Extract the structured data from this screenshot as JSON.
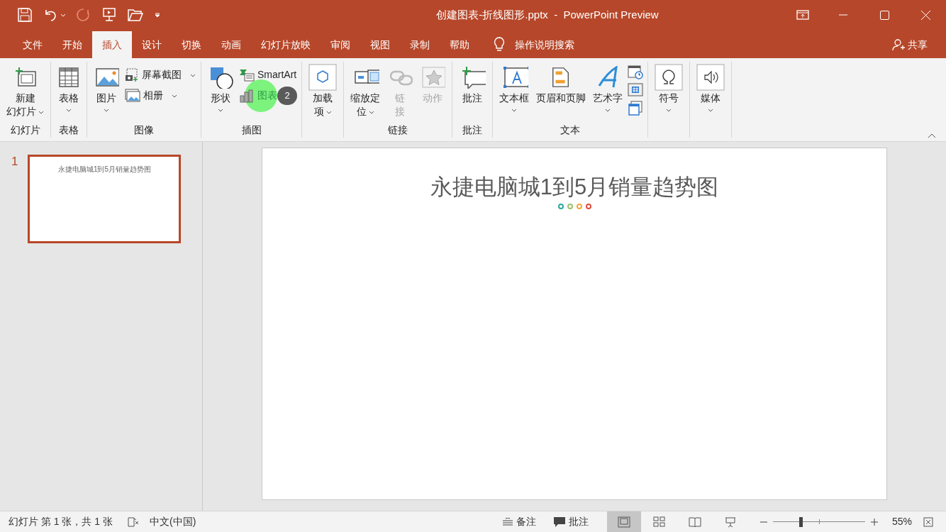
{
  "title_bar": {
    "title": "创建图表-折线图形.pptx  -  PowerPoint Preview"
  },
  "tabs": [
    {
      "label": "文件",
      "selected": false
    },
    {
      "label": "开始",
      "selected": false
    },
    {
      "label": "插入",
      "selected": true
    },
    {
      "label": "设计",
      "selected": false
    },
    {
      "label": "切换",
      "selected": false
    },
    {
      "label": "动画",
      "selected": false
    },
    {
      "label": "幻灯片放映",
      "selected": false
    },
    {
      "label": "审阅",
      "selected": false
    },
    {
      "label": "视图",
      "selected": false
    },
    {
      "label": "录制",
      "selected": false
    },
    {
      "label": "帮助",
      "selected": false
    }
  ],
  "search": {
    "placeholder": "操作说明搜索"
  },
  "share": {
    "label": "共享"
  },
  "ribbon": [
    {
      "label": "幻灯片",
      "items": [
        {
          "kind": "large",
          "lines": [
            "新建",
            "幻灯片"
          ],
          "dropdown": true,
          "disabled": false
        }
      ]
    },
    {
      "label": "表格",
      "items": [
        {
          "kind": "large",
          "lines": [
            "表格"
          ],
          "dropdown": true,
          "disabled": false
        }
      ]
    },
    {
      "label": "图像",
      "items": [
        {
          "kind": "large",
          "lines": [
            "图片"
          ],
          "dropdown": true,
          "disabled": false
        },
        {
          "kind": "column",
          "items": [
            {
              "label": "屏幕截图",
              "dropdown": true,
              "highlight": false
            },
            {
              "label": "相册",
              "dropdown": true,
              "highlight": false
            }
          ]
        }
      ]
    },
    {
      "label": "插图",
      "items": [
        {
          "kind": "large",
          "lines": [
            "形状"
          ],
          "dropdown": true,
          "disabled": false
        },
        {
          "kind": "column",
          "items": [
            {
              "label": "SmartArt",
              "dropdown": false,
              "highlight": false
            },
            {
              "label": "图表",
              "dropdown": false,
              "highlight": true,
              "step": "2"
            }
          ]
        }
      ]
    },
    {
      "items": [
        {
          "kind": "large",
          "lines": [
            "加载",
            "项"
          ],
          "dropdown": true,
          "disabled": false
        }
      ]
    },
    {
      "label": "链接",
      "items": [
        {
          "kind": "large",
          "lines": [
            "缩放定",
            "位"
          ],
          "dropdown": true,
          "disabled": false
        },
        {
          "kind": "large",
          "lines": [
            "链",
            "接"
          ],
          "dropdown": false,
          "disabled": true
        },
        {
          "kind": "large",
          "lines": [
            "动作"
          ],
          "dropdown": false,
          "disabled": true
        }
      ]
    },
    {
      "label": "批注",
      "items": [
        {
          "kind": "large",
          "lines": [
            "批注"
          ],
          "dropdown": false,
          "disabled": false
        }
      ]
    },
    {
      "label": "文本",
      "items": [
        {
          "kind": "large",
          "lines": [
            "文本框"
          ],
          "dropdown": true,
          "disabled": false
        },
        {
          "kind": "large",
          "lines": [
            "页眉和页脚"
          ],
          "dropdown": false,
          "disabled": false
        },
        {
          "kind": "large",
          "lines": [
            "艺术字"
          ],
          "dropdown": true,
          "disabled": false
        },
        {
          "kind": "icons",
          "buttons": [
            {
              "disabled": false
            },
            {
              "disabled": false
            },
            {
              "disabled": false
            }
          ]
        }
      ]
    },
    {
      "items": [
        {
          "kind": "large",
          "lines": [
            "符号"
          ],
          "dropdown": true,
          "disabled": false
        }
      ]
    },
    {
      "items": [
        {
          "kind": "large",
          "lines": [
            "媒体"
          ],
          "dropdown": true,
          "disabled": false
        }
      ]
    }
  ],
  "slides": [
    {
      "number": "1",
      "selected": true,
      "title": "永捷电脑城1到5月销量趋势图"
    }
  ],
  "slide": {
    "title": "永捷电脑城1到5月销量趋势图",
    "dots": [
      {
        "color": "#2aa89a"
      },
      {
        "color": "#9cc26b"
      },
      {
        "color": "#f2a93b"
      },
      {
        "color": "#d9503f"
      }
    ]
  },
  "status_bar": {
    "slide_info": "幻灯片 第 1 张，共 1 张",
    "language": "中文(中国)",
    "notes": "备注",
    "comments": "批注",
    "views": [
      {
        "selected": true
      },
      {
        "selected": false
      },
      {
        "selected": false
      },
      {
        "selected": false
      }
    ],
    "zoom": {
      "level": 0.3
    },
    "zoom_text": "55%"
  }
}
